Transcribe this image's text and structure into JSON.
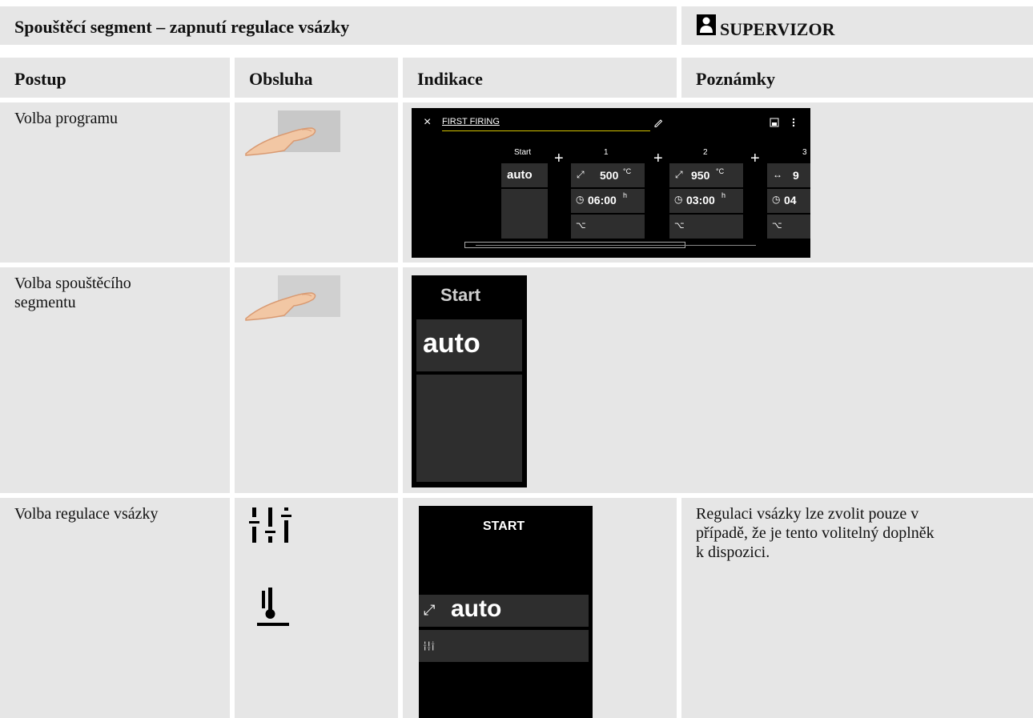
{
  "header": {
    "title": "Spouštěcí segment – zapnutí regulace vsázky",
    "role": "SUPERVIZOR",
    "role_icon": "user-icon"
  },
  "columns": [
    "Postup",
    "Obsluha",
    "Indikace",
    "Poznámky"
  ],
  "rows": [
    {
      "step": "Volba programu",
      "operation_icon": "finger-touch-icon",
      "note": ""
    },
    {
      "step": "Volba spouštěcího segmentu",
      "operation_icon": "finger-touch-icon",
      "note": ""
    },
    {
      "step": "Volba regulace vsázky",
      "operation_icons": [
        "sliders-icon",
        "charge-control-icon"
      ],
      "note": "Regulaci vsázky lze zvolit pouze v případě, že je tento volitelný doplněk k dispozici."
    }
  ],
  "screen1": {
    "close": "×",
    "program_name": "FIRST FIRING",
    "start_label": "Start",
    "start_value": "auto",
    "segments": [
      {
        "num": "1",
        "temp": "500",
        "temp_unit": "°C",
        "time": "06:00",
        "time_unit": "h"
      },
      {
        "num": "2",
        "temp": "950",
        "temp_unit": "°C",
        "time": "03:00",
        "time_unit": "h"
      },
      {
        "num": "3",
        "temp": "9",
        "temp_unit": "",
        "time": "04",
        "time_unit": ""
      }
    ]
  },
  "screen2": {
    "title": "Start",
    "value": "auto"
  },
  "screen3": {
    "title": "START",
    "value": "auto"
  }
}
